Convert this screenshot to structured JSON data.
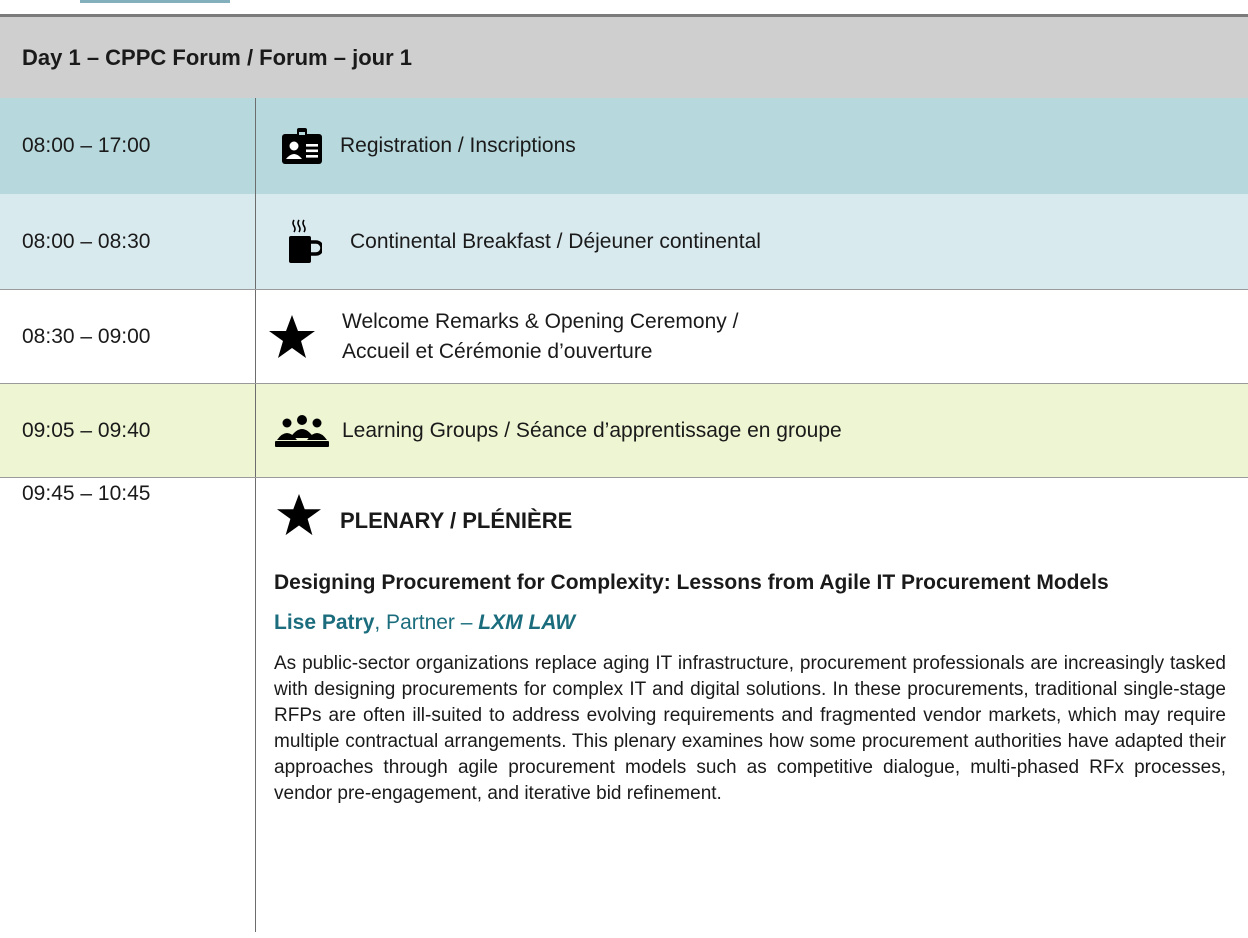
{
  "header": {
    "title": "Day 1 – CPPC Forum / Forum – jour 1"
  },
  "rows": [
    {
      "time": "08:00 – 17:00",
      "label": "Registration / Inscriptions",
      "icon": "id-badge-icon",
      "bg": "#b7d8dc"
    },
    {
      "time": "08:00 – 08:30",
      "label": "Continental Breakfast / Déjeuner continental",
      "icon": "coffee-cup-icon",
      "bg": "#d9eaef"
    },
    {
      "time": "08:30 – 09:00",
      "label_line1": "Welcome Remarks & Opening Ceremony /",
      "label_line2": "Accueil et Cérémonie d’ouverture",
      "icon": "star-icon",
      "bg": "#ffffff"
    },
    {
      "time": "09:05 – 09:40",
      "label": "Learning Groups / Séance d’apprentissage en groupe",
      "icon": "group-icon",
      "bg": "#eef5d2"
    }
  ],
  "plenary": {
    "time": "09:45 – 10:45",
    "icon": "star-icon",
    "heading": "PLENARY / PLÉNIÈRE",
    "title": "Designing Procurement for Complexity: Lessons from Agile IT Procurement Models",
    "speaker_name": "Lise Patry",
    "speaker_role": ", Partner – ",
    "speaker_firm": "LXM LAW",
    "abstract": "As public-sector organizations replace aging IT infrastructure, procurement professionals are increasingly tasked with designing procurements for complex IT and digital solutions. In these procurements, traditional single-stage RFPs are often ill-suited to address evolving requirements and fragmented vendor markets, which may require multiple contractual arrangements. This plenary examines how some procurement authorities have adapted their approaches through agile procurement models such as competitive dialogue, multi-phased RFx processes, vendor pre-engagement, and iterative bid refinement."
  },
  "colors": {
    "accent": "#1b6d7d",
    "header_bg": "#cfcfcf"
  }
}
